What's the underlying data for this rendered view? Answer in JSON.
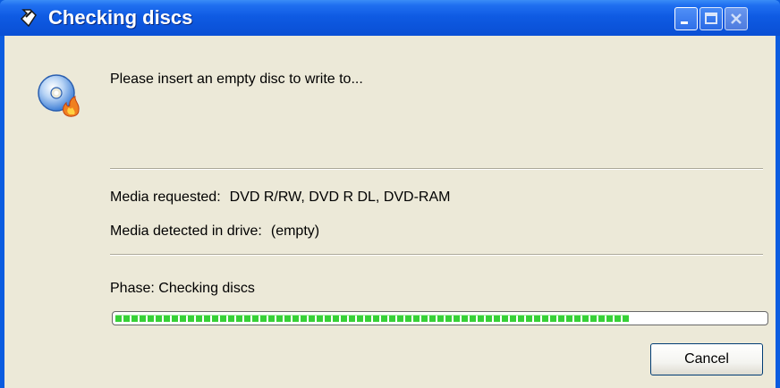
{
  "window": {
    "title": "Checking discs",
    "icons": {
      "app": "burn-app-icon",
      "minimize": "minimize-icon",
      "maximize": "maximize-icon",
      "close": "close-icon",
      "disc": "disc-burn-icon"
    }
  },
  "dialog": {
    "message": "Please insert an empty disc to write to...",
    "media_requested_label": "Media requested:",
    "media_requested_value": "DVD R/RW, DVD R DL, DVD-RAM",
    "media_detected_label": "Media detected in drive:",
    "media_detected_value": "(empty)",
    "phase": "Phase: Checking discs",
    "progress_fraction": 0.79,
    "cancel_label": "Cancel"
  },
  "colors": {
    "titlebar": "#0b5ce0",
    "client_bg": "#ece9d8",
    "progress_green": "#37d137"
  }
}
